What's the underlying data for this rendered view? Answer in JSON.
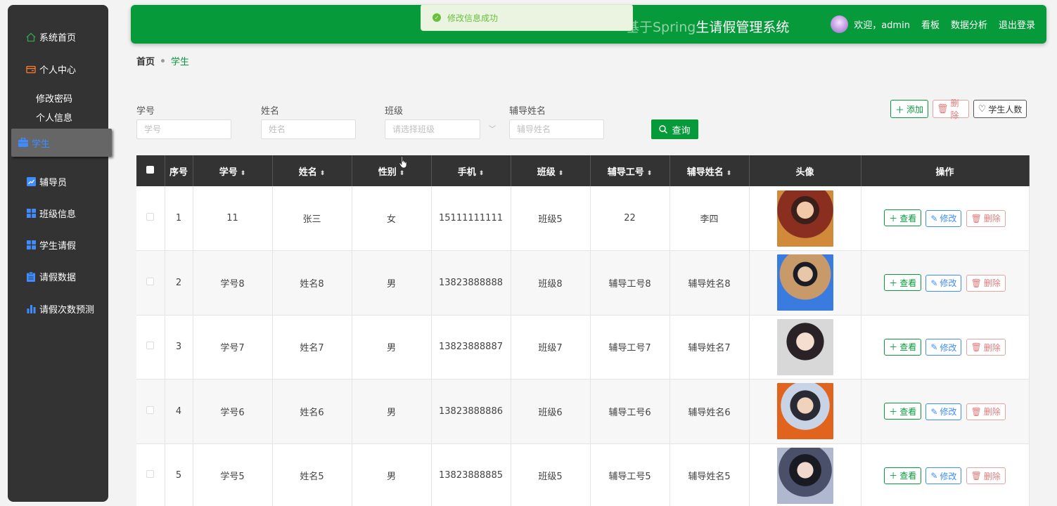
{
  "header": {
    "title_prefix": "基于Spring",
    "title": "生请假管理系统",
    "welcome": "欢迎，admin",
    "links": [
      "看板",
      "数据分析",
      "退出登录"
    ]
  },
  "toast": {
    "message": "修改信息成功"
  },
  "sidebar": {
    "items": [
      {
        "label": "系统首页",
        "icon": "home-icon"
      },
      {
        "label": "个人中心",
        "icon": "card-icon"
      },
      {
        "label": "学生",
        "icon": "briefcase-icon",
        "active": true
      },
      {
        "label": "辅导员",
        "icon": "chart-line-icon"
      },
      {
        "label": "班级信息",
        "icon": "grid-icon"
      },
      {
        "label": "学生请假",
        "icon": "grid-icon"
      },
      {
        "label": "请假数据",
        "icon": "clipboard-icon"
      },
      {
        "label": "请假次数预测",
        "icon": "bar-chart-icon"
      }
    ],
    "sub_items": [
      "修改密码",
      "个人信息"
    ]
  },
  "breadcrumb": {
    "home": "首页",
    "current": "学生"
  },
  "search": {
    "fields": [
      {
        "label": "学号",
        "placeholder": "学号"
      },
      {
        "label": "姓名",
        "placeholder": "姓名"
      },
      {
        "label": "班级",
        "placeholder": "请选择班级"
      },
      {
        "label": "辅导姓名",
        "placeholder": "辅导姓名"
      }
    ],
    "query_label": "查询"
  },
  "actions": {
    "add": "添加",
    "delete": "删除",
    "count": "学生人数"
  },
  "table": {
    "headers": [
      "序号",
      "学号",
      "姓名",
      "性别",
      "手机",
      "班级",
      "辅导工号",
      "辅导姓名",
      "头像",
      "操作"
    ],
    "op_labels": {
      "view": "查看",
      "edit": "修改",
      "delete": "删除"
    },
    "rows": [
      {
        "idx": "1",
        "xuehao": "11",
        "name": "张三",
        "gender": "女",
        "phone": "15111111111",
        "class": "班级5",
        "tid": "22",
        "tname": "李四"
      },
      {
        "idx": "2",
        "xuehao": "学号8",
        "name": "姓名8",
        "gender": "男",
        "phone": "13823888888",
        "class": "班级8",
        "tid": "辅导工号8",
        "tname": "辅导姓名8"
      },
      {
        "idx": "3",
        "xuehao": "学号7",
        "name": "姓名7",
        "gender": "男",
        "phone": "13823888887",
        "class": "班级7",
        "tid": "辅导工号7",
        "tname": "辅导姓名7"
      },
      {
        "idx": "4",
        "xuehao": "学号6",
        "name": "姓名6",
        "gender": "男",
        "phone": "13823888886",
        "class": "班级6",
        "tid": "辅导工号6",
        "tname": "辅导姓名6"
      },
      {
        "idx": "5",
        "xuehao": "学号5",
        "name": "姓名5",
        "gender": "男",
        "phone": "13823888885",
        "class": "班级5",
        "tid": "辅导工号5",
        "tname": "辅导姓名5"
      }
    ]
  },
  "colors": {
    "primary": "#079a3a",
    "sidebar": "#333333",
    "active": "#3f8cff",
    "danger": "#e07b7b"
  }
}
